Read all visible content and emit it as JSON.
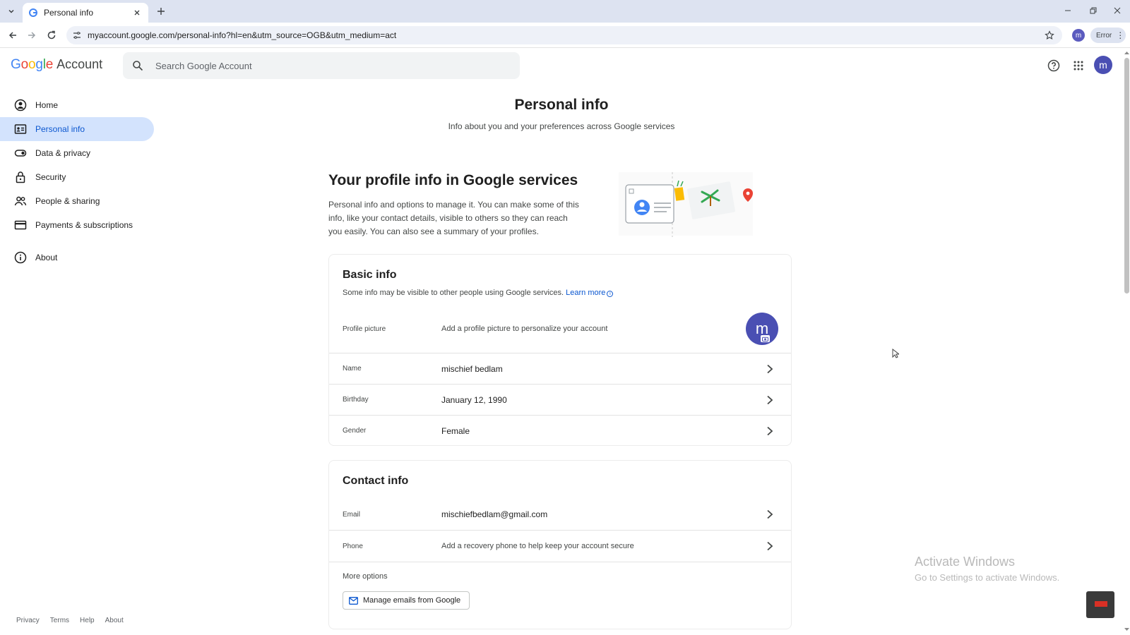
{
  "browser": {
    "tab_title": "Personal info",
    "url": "myaccount.google.com/personal-info?hl=en&utm_source=OGB&utm_medium=act",
    "profile_initial": "m",
    "error_label": "Error"
  },
  "header": {
    "logo_google": "Google",
    "logo_account": "Account",
    "search_placeholder": "Search Google Account",
    "avatar_initial": "m"
  },
  "sidebar": {
    "items": [
      {
        "label": "Home",
        "icon": "account-circle-icon"
      },
      {
        "label": "Personal info",
        "icon": "id-card-icon",
        "active": true
      },
      {
        "label": "Data & privacy",
        "icon": "toggle-icon"
      },
      {
        "label": "Security",
        "icon": "lock-icon"
      },
      {
        "label": "People & sharing",
        "icon": "people-icon"
      },
      {
        "label": "Payments & subscriptions",
        "icon": "credit-card-icon"
      },
      {
        "label": "About",
        "icon": "info-icon"
      }
    ],
    "footer": [
      "Privacy",
      "Terms",
      "Help",
      "About"
    ]
  },
  "main": {
    "title": "Personal info",
    "subtitle": "Info about you and your preferences across Google services",
    "intro_title": "Your profile info in Google services",
    "intro_text": "Personal info and options to manage it. You can make some of this info, like your contact details, visible to others so they can reach you easily. You can also see a summary of your profiles."
  },
  "basic_info": {
    "title": "Basic info",
    "desc": "Some info may be visible to other people using Google services.",
    "learn_more": "Learn more",
    "profile_picture": {
      "label": "Profile picture",
      "value": "Add a profile picture to personalize your account",
      "initial": "m"
    },
    "name": {
      "label": "Name",
      "value": "mischief bedlam"
    },
    "birthday": {
      "label": "Birthday",
      "value": "January 12, 1990"
    },
    "gender": {
      "label": "Gender",
      "value": "Female"
    }
  },
  "contact_info": {
    "title": "Contact info",
    "email": {
      "label": "Email",
      "value": "mischiefbedlam@gmail.com"
    },
    "phone": {
      "label": "Phone",
      "value": "Add a recovery phone to help keep your account secure"
    },
    "more_options": "More options",
    "manage_emails": "Manage emails from Google"
  },
  "overlay": {
    "watermark_line1": "Activate Windows",
    "watermark_line2": "Go to Settings to activate Windows."
  },
  "colors": {
    "accent": "#0b57d0",
    "active_nav_bg": "#d3e3fd",
    "avatar": "#4a4fb3"
  }
}
